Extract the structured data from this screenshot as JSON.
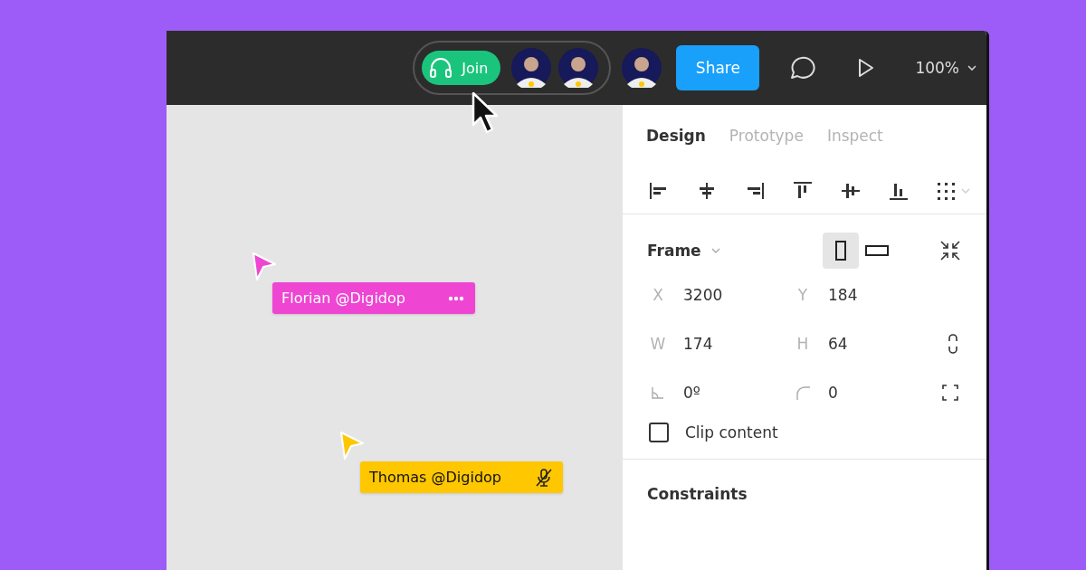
{
  "toolbar": {
    "join_button": {
      "label": "Join"
    },
    "call_avatars": [
      {
        "speaking": true
      },
      {
        "speaking": true
      }
    ],
    "other_avatars": [
      {
        "speaking": true
      }
    ],
    "share_button": {
      "label": "Share"
    },
    "zoom": {
      "value": "100%"
    }
  },
  "canvas": {
    "cursors": [
      {
        "name": "Florian @Digidop",
        "color": "#ee46d3",
        "kind": "more"
      },
      {
        "name": "Thomas @Digidop",
        "color": "#ffc700",
        "kind": "muted"
      }
    ]
  },
  "panel": {
    "tabs": [
      {
        "label": "Design",
        "selected": true
      },
      {
        "label": "Prototype",
        "selected": false
      },
      {
        "label": "Inspect",
        "selected": false
      }
    ],
    "frame": {
      "title": "Frame",
      "portrait": true,
      "fields": [
        {
          "kind": "letter",
          "label": "X",
          "value": "3200"
        },
        {
          "kind": "letter",
          "label": "Y",
          "value": "184"
        },
        {
          "kind": "letter",
          "label": "W",
          "value": "174"
        },
        {
          "kind": "letter",
          "label": "H",
          "value": "64"
        },
        {
          "kind": "angle",
          "value": "0º"
        },
        {
          "kind": "corner",
          "value": "0"
        }
      ],
      "clip_content": {
        "label": "Clip content",
        "checked": false
      }
    },
    "constraints": {
      "title": "Constraints"
    }
  }
}
